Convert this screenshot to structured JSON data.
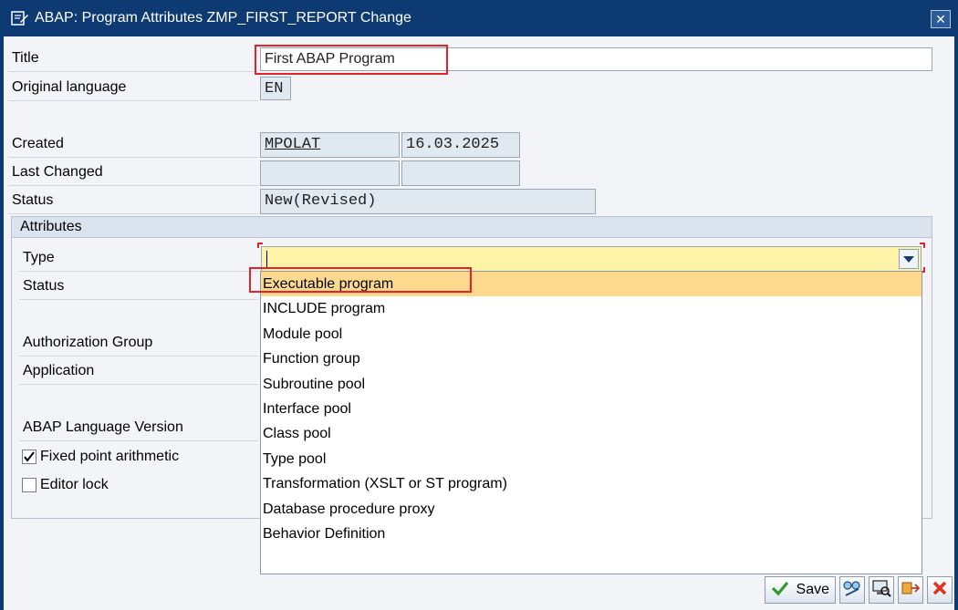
{
  "window": {
    "title": "ABAP: Program Attributes ZMP_FIRST_REPORT Change",
    "close_glyph": "✕"
  },
  "header_fields": {
    "title_label": "Title",
    "title_value": "First ABAP Program",
    "orig_lang_label": "Original language",
    "orig_lang_value": "EN",
    "created_label": "Created",
    "created_by": "MPOLAT",
    "created_on": "16.03.2025",
    "last_changed_label": "Last Changed",
    "last_changed_by": "",
    "last_changed_on": "",
    "status_label": "Status",
    "status_value": "New(Revised)"
  },
  "attributes": {
    "section_label": "Attributes",
    "type_label": "Type",
    "type_value": "",
    "status_label": "Status",
    "auth_group_label": "Authorization Group",
    "application_label": "Application",
    "abap_lang_label": "ABAP Language Version",
    "fixed_point_label": "Fixed point arithmetic",
    "fixed_point_checked": true,
    "editor_lock_label": "Editor lock",
    "editor_lock_checked": false
  },
  "type_options": [
    "Executable program",
    "INCLUDE program",
    "Module pool",
    "Function group",
    "Subroutine pool",
    "Interface pool",
    "Class pool",
    "Type pool",
    "Transformation (XSLT or ST program)",
    "Database procedure proxy",
    "Behavior Definition"
  ],
  "selected_option_index": 0,
  "toolbar": {
    "save_label": "Save",
    "icons": [
      "check-icon",
      "glasses-icon",
      "screen-icon",
      "transport-icon",
      "cancel-icon"
    ]
  },
  "colors": {
    "titlebar": "#0e3a73",
    "highlight_box": "#e5212a",
    "selected_row": "#fdd98e",
    "type_field": "#fff3a8"
  }
}
